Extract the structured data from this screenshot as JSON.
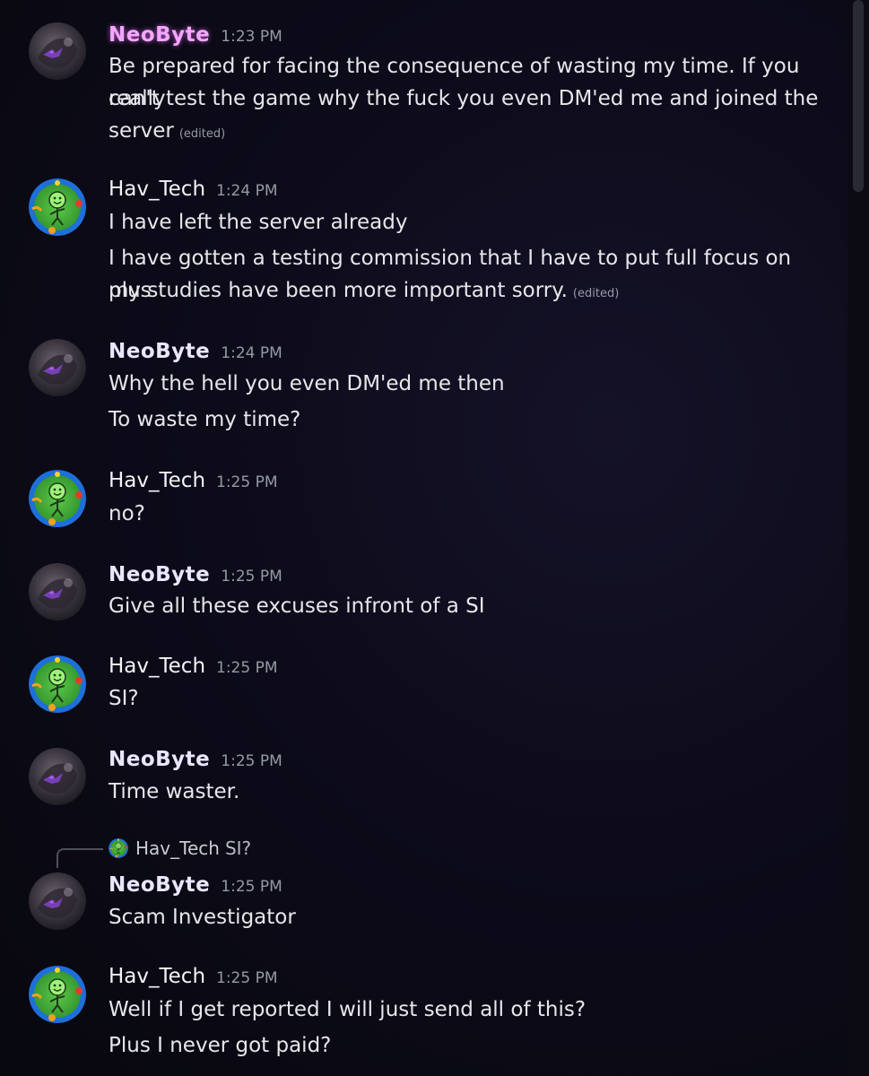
{
  "messages": [
    {
      "author": "NeoByte",
      "time": "1:23 PM",
      "lines": [
        "Be prepared for facing the consequence of wasting my time. If you really",
        "can't test the game why the fuck you even DM'ed me and joined the",
        "server"
      ],
      "edited": "(edited)"
    },
    {
      "author": "Hav_Tech",
      "time": "1:24 PM",
      "lines": [
        "I have left the server already",
        "I have gotten a testing commission that I have to put full focus on plus",
        "my studies have been more important sorry."
      ],
      "edited": "(edited)"
    },
    {
      "author": "NeoByte",
      "time": "1:24 PM",
      "lines": [
        "Why the hell you even DM'ed me then",
        "To waste my time?"
      ]
    },
    {
      "author": "Hav_Tech",
      "time": "1:25 PM",
      "lines": [
        "no?"
      ]
    },
    {
      "author": "NeoByte",
      "time": "1:25 PM",
      "lines": [
        "Give all these excuses infront of a SI"
      ]
    },
    {
      "author": "Hav_Tech",
      "time": "1:25 PM",
      "lines": [
        "SI?"
      ]
    },
    {
      "author": "NeoByte",
      "time": "1:25 PM",
      "lines": [
        "Time waster."
      ]
    },
    {
      "reply_to": {
        "author": "Hav_Tech",
        "text": "SI?"
      },
      "author": "NeoByte",
      "time": "1:25 PM",
      "lines": [
        "Scam Investigator"
      ]
    },
    {
      "author": "Hav_Tech",
      "time": "1:25 PM",
      "lines": [
        "Well if I get reported I will just send all of this?",
        "Plus I never got paid?"
      ]
    }
  ],
  "colors": {
    "background": "#0a0a14",
    "text": "#e6e7ea",
    "timestamp": "#949ba4",
    "neobyte_highlight": "#f4a6ff"
  },
  "icons": {
    "neobyte_avatar": "dark-purple-creature-avatar",
    "havtech_avatar": "green-smiley-stickman-avatar"
  }
}
